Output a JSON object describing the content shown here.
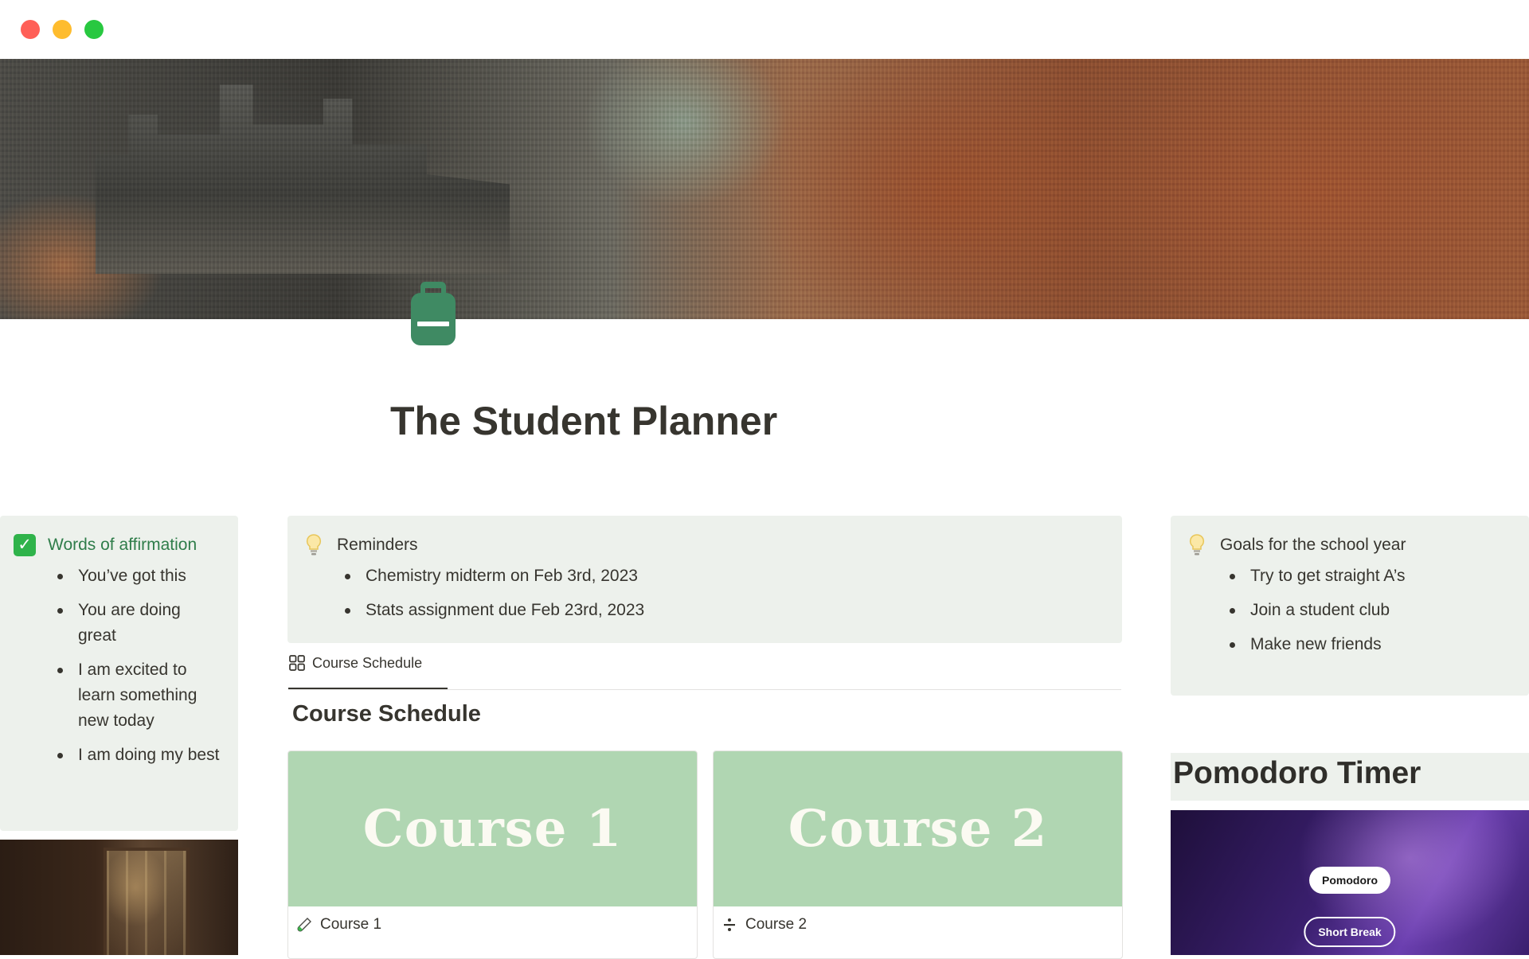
{
  "window": {
    "controls": [
      "close",
      "minimize",
      "zoom"
    ]
  },
  "page": {
    "title": "The Student Planner",
    "icon": "backpack-icon"
  },
  "affirmation": {
    "heading": "Words of affirmation",
    "icon": "check-icon",
    "items": [
      "You’ve got this",
      "You are doing great",
      "I am excited to learn something new today",
      "I am doing my best"
    ]
  },
  "reminders": {
    "heading": "Reminders",
    "icon": "lightbulb-icon",
    "items": [
      "Chemistry midterm on Feb 3rd, 2023",
      "Stats assignment due Feb 23rd, 2023"
    ]
  },
  "goals": {
    "heading": "Goals for the school year",
    "icon": "lightbulb-icon",
    "items": [
      "Try to get straight A’s",
      "Join a student club",
      "Make new friends"
    ]
  },
  "schedule": {
    "tab_label": "Course Schedule",
    "heading": "Course Schedule",
    "cards": [
      {
        "cover_text": "Course 1",
        "title": "Course 1",
        "icon": "test-tube-icon"
      },
      {
        "cover_text": "Course 2",
        "title": "Course 2",
        "icon": "divide-icon"
      }
    ]
  },
  "pomodoro": {
    "heading": "Pomodoro Timer",
    "buttons": [
      "Pomodoro",
      "Short Break"
    ]
  },
  "colors": {
    "callout_bg": "#edf1ec",
    "accent_green": "#2f7d4a",
    "card_cover": "#b0d6b2",
    "backpack": "#3f8a63"
  }
}
